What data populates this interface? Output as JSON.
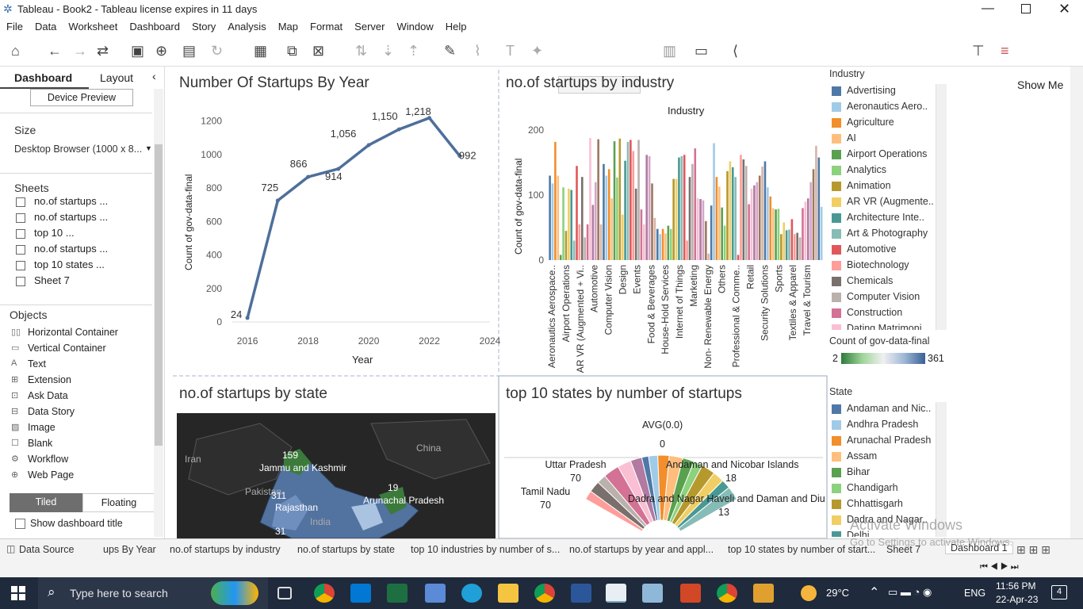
{
  "window": {
    "title": "Tableau - Book2 - Tableau license expires in 11 days"
  },
  "menu": [
    "File",
    "Data",
    "Worksheet",
    "Dashboard",
    "Story",
    "Analysis",
    "Map",
    "Format",
    "Server",
    "Window",
    "Help"
  ],
  "toolbar": {
    "show_me": "Show Me"
  },
  "left": {
    "tab_dashboard": "Dashboard",
    "tab_layout": "Layout",
    "device_preview": "Device Preview",
    "size_label": "Size",
    "size_value": "Desktop Browser (1000 x 8...",
    "sheets_label": "Sheets",
    "sheets": [
      "no.of startups ...",
      "no.of startups ...",
      "top 10 ...",
      "no.of startups ...",
      "top 10 states ...",
      "Sheet 7"
    ],
    "objects_label": "Objects",
    "objects": [
      "Horizontal Container",
      "Vertical Container",
      "Text",
      "Extension",
      "Ask Data",
      "Data Story",
      "Image",
      "Blank",
      "Workflow",
      "Web Page"
    ],
    "tiled": "Tiled",
    "floating": "Floating",
    "show_title": "Show dashboard title"
  },
  "line_chart": {
    "title": "Number Of Startups By Year",
    "ylabel": "Count of gov-data-final",
    "xlabel": "Year"
  },
  "bar_chart": {
    "title": "no.of startups by industry",
    "header": "Industry",
    "ylabel": "Count of gov-data-final"
  },
  "map": {
    "title": "no.of startups by state",
    "labels": [
      "Iran",
      "China",
      "Pakistan",
      "Jammu and Kashmir",
      "Rajasthan",
      "Arunachal Pradesh",
      "India"
    ],
    "values": [
      "159",
      "311",
      "19",
      "31"
    ]
  },
  "pie": {
    "title": "top 10 states by number of startups",
    "avg_label": "AVG(0.0)",
    "avg_value": "0",
    "labels": [
      {
        "name": "Uttar Pradesh",
        "val": "70"
      },
      {
        "name": "Tamil Nadu",
        "val": "70"
      },
      {
        "name": "Andaman and Nicobar Islands",
        "val": "18"
      },
      {
        "name": "Dadra and Nagar Haveli and Daman and Diu",
        "val": "13"
      }
    ]
  },
  "industry_legend": {
    "title": "Industry",
    "items": [
      {
        "label": "Advertising",
        "color": "#4e79a7"
      },
      {
        "label": "Aeronautics Aero..",
        "color": "#a0cbe8"
      },
      {
        "label": "Agriculture",
        "color": "#f28e2b"
      },
      {
        "label": "AI",
        "color": "#ffbe7d"
      },
      {
        "label": "Airport Operations",
        "color": "#59a14f"
      },
      {
        "label": "Analytics",
        "color": "#8cd17d"
      },
      {
        "label": "Animation",
        "color": "#b6992d"
      },
      {
        "label": "AR VR (Augmente..",
        "color": "#f1ce63"
      },
      {
        "label": "Architecture Inte..",
        "color": "#499894"
      },
      {
        "label": "Art & Photography",
        "color": "#86bcb6"
      },
      {
        "label": "Automotive",
        "color": "#e15759"
      },
      {
        "label": "Biotechnology",
        "color": "#ff9d9a"
      },
      {
        "label": "Chemicals",
        "color": "#79706e"
      },
      {
        "label": "Computer Vision",
        "color": "#bab0ac"
      },
      {
        "label": "Construction",
        "color": "#d37295"
      },
      {
        "label": "Dating Matrimoni..",
        "color": "#fabfd2"
      }
    ]
  },
  "count_legend": {
    "title": "Count of gov-data-final",
    "min": "2",
    "max": "361"
  },
  "state_legend": {
    "title": "State",
    "items": [
      {
        "label": "Andaman and Nic..",
        "color": "#4e79a7"
      },
      {
        "label": "Andhra Pradesh",
        "color": "#a0cbe8"
      },
      {
        "label": "Arunachal Pradesh",
        "color": "#f28e2b"
      },
      {
        "label": "Assam",
        "color": "#ffbe7d"
      },
      {
        "label": "Bihar",
        "color": "#59a14f"
      },
      {
        "label": "Chandigarh",
        "color": "#8cd17d"
      },
      {
        "label": "Chhattisgarh",
        "color": "#b6992d"
      },
      {
        "label": "Dadra and Nagar..",
        "color": "#f1ce63"
      },
      {
        "label": "Delhi",
        "color": "#499894"
      }
    ]
  },
  "watermark": {
    "line1": "Activate Windows",
    "line2": "Go to Settings to activate Windows."
  },
  "tabs": [
    "Data Source",
    "ups By Year",
    "no.of startups by industry",
    "no.of startups by state",
    "top 10 industries by number of s...",
    "no.of startups by  year and appl...",
    "top 10 states by number of start...",
    "Sheet 7",
    "Dashboard 1"
  ],
  "taskbar": {
    "search": "Type here to search",
    "temp": "29°C",
    "lang": "ENG",
    "time": "11:56 PM",
    "date": "22-Apr-23",
    "notif": "4"
  },
  "chart_data": [
    {
      "type": "line",
      "title": "Number Of Startups By Year",
      "xlabel": "Year",
      "ylabel": "Count of gov-data-final",
      "x": [
        2016,
        2017,
        2018,
        2019,
        2020,
        2021,
        2022,
        2023
      ],
      "values": [
        24,
        725,
        866,
        914,
        1056,
        1150,
        1218,
        992
      ],
      "labels": [
        "24",
        "725",
        "866",
        "914",
        "1,056",
        "1,150",
        "1,218",
        "992"
      ],
      "xlim": [
        2015.5,
        2024
      ],
      "ylim": [
        0,
        1250
      ],
      "xticks": [
        2016,
        2018,
        2020,
        2022,
        2024
      ],
      "yticks": [
        0,
        200,
        400,
        600,
        800,
        1000,
        1200
      ]
    },
    {
      "type": "bar",
      "title": "no.of startups by industry",
      "ylabel": "Count of gov-data-final",
      "ylim": [
        0,
        210
      ],
      "yticks": [
        0,
        100,
        200
      ],
      "categories": [
        "Aeronautics Aerospace..",
        "Airport Operations",
        "AR VR (Augmented + Vi..",
        "Automotive",
        "Computer Vision",
        "Design",
        "Events",
        "Food & Beverages",
        "House-Hold Services",
        "Internet of Things",
        "Marketing",
        "Non- Renewable Energy",
        "Others",
        "Professional & Comme..",
        "Retail",
        "Security Solutions",
        "Sports",
        "Textiles & Apparel",
        "Travel & Tourism"
      ],
      "values": [
        130,
        118,
        182,
        130,
        8,
        112,
        45,
        110,
        108,
        30,
        145,
        55,
        128,
        35,
        55,
        188,
        85,
        120,
        186,
        55,
        148,
        130,
        140,
        95,
        183,
        127,
        187,
        70,
        153,
        182,
        185,
        168,
        110,
        185,
        78,
        55,
        162,
        160,
        118,
        65,
        48,
        40,
        48,
        41,
        53,
        48,
        125,
        125,
        158,
        160,
        162,
        30,
        128,
        148,
        172,
        95,
        94,
        92,
        60,
        10,
        84,
        180,
        128,
        113,
        81,
        53,
        137,
        152,
        143,
        128,
        8,
        162,
        155,
        145,
        86,
        110,
        115,
        120,
        130,
        144,
        152,
        112,
        98,
        80,
        78,
        79,
        40,
        58,
        46,
        47,
        63,
        40,
        42,
        35,
        80,
        90,
        95,
        120,
        140,
        176,
        158,
        82
      ],
      "colors": [
        "#4e79a7",
        "#a0cbe8",
        "#f28e2b",
        "#ffbe7d",
        "#59a14f",
        "#8cd17d",
        "#b6992d",
        "#f1ce63",
        "#499894",
        "#86bcb6",
        "#e15759",
        "#ff9d9a",
        "#79706e",
        "#bab0ac",
        "#d37295",
        "#fabfd2",
        "#b07aa1",
        "#d4a6c8",
        "#9d7660",
        "#d7b5a6"
      ]
    },
    {
      "type": "pie",
      "title": "top 10 states by number of startups",
      "categories": [
        "Uttar Pradesh",
        "Tamil Nadu",
        "Andaman and Nicobar Islands",
        "Dadra and Nagar Haveli and Daman and Diu"
      ],
      "values": [
        70,
        70,
        18,
        13
      ]
    }
  ]
}
